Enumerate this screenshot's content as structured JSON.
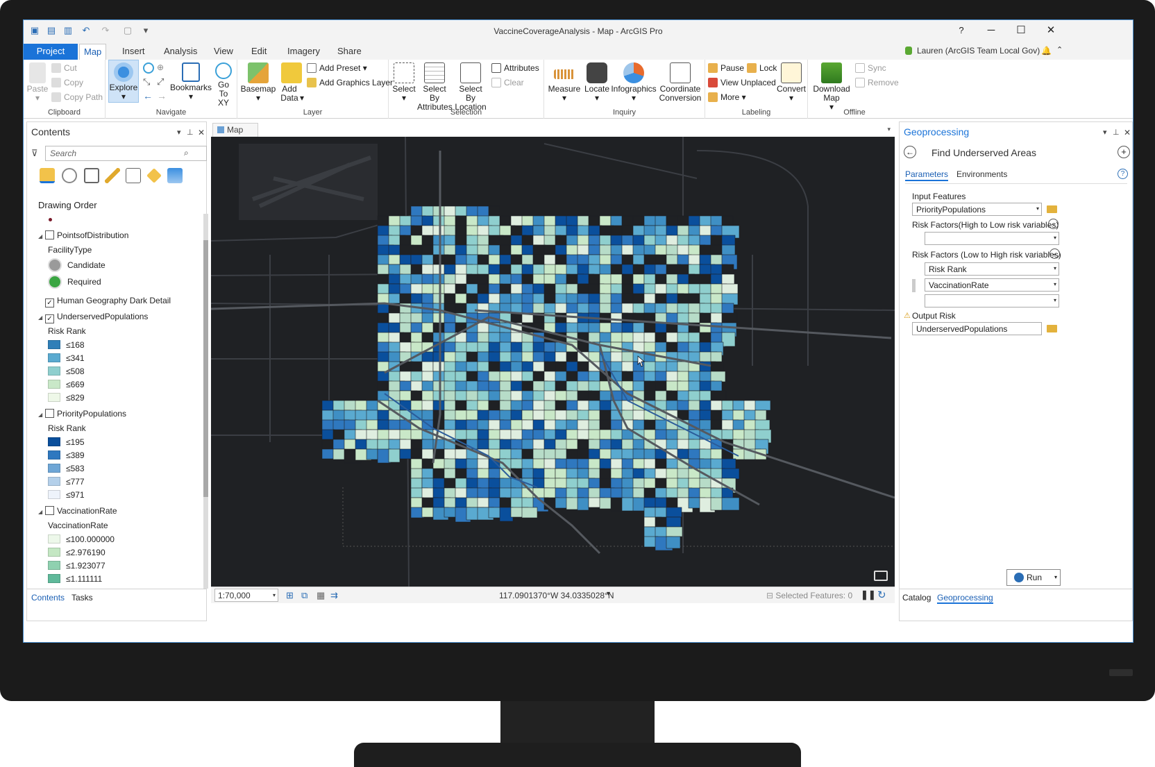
{
  "window": {
    "title": "VaccineCoverageAnalysis - Map - ArcGIS Pro",
    "help": "?"
  },
  "tabs": [
    "Project",
    "Map",
    "Insert",
    "Analysis",
    "View",
    "Edit",
    "Imagery",
    "Share"
  ],
  "active_tab": "Map",
  "user": "Lauren (ArcGIS Team Local Gov)",
  "ribbon": {
    "clipboard": {
      "label": "Clipboard",
      "paste": "Paste",
      "cut": "Cut",
      "copy": "Copy",
      "copy_path": "Copy Path"
    },
    "navigate": {
      "label": "Navigate",
      "explore": "Explore",
      "bookmarks": "Bookmarks",
      "go_to_xy": "Go To XY"
    },
    "layer": {
      "label": "Layer",
      "basemap": "Basemap",
      "add_data": "Add Data",
      "add_preset": "Add Preset",
      "add_graphics_layer": "Add Graphics Layer"
    },
    "selection": {
      "label": "Selection",
      "select": "Select",
      "select_by_attributes": "Select By Attributes",
      "select_by_location": "Select By Location",
      "attributes": "Attributes",
      "clear": "Clear"
    },
    "inquiry": {
      "label": "Inquiry",
      "measure": "Measure",
      "locate": "Locate",
      "infographics": "Infographics",
      "coordinate_conversion": "Coordinate Conversion"
    },
    "labeling": {
      "label": "Labeling",
      "pause": "Pause",
      "lock": "Lock",
      "view_unplaced": "View Unplaced",
      "more": "More",
      "convert": "Convert"
    },
    "offline": {
      "label": "Offline",
      "download_map": "Download Map",
      "sync": "Sync",
      "remove": "Remove"
    }
  },
  "contents": {
    "title": "Contents",
    "search_placeholder": "Search",
    "drawing_order": "Drawing Order",
    "layers": [
      {
        "name": "PointsofDistribution",
        "checked": false,
        "field": "FacilityType",
        "classes": [
          {
            "label": "Candidate"
          },
          {
            "label": "Required"
          }
        ]
      },
      {
        "name": "Human Geography Dark Detail",
        "checked": true
      },
      {
        "name": "UnderservedPopulations",
        "checked": true,
        "field": "Risk Rank",
        "classes": [
          {
            "label": "≤168",
            "color": "#2f7fb8"
          },
          {
            "label": "≤341",
            "color": "#5aaad0"
          },
          {
            "label": "≤508",
            "color": "#8fcfce"
          },
          {
            "label": "≤669",
            "color": "#c9e8c8"
          },
          {
            "label": "≤829",
            "color": "#eef8e8"
          }
        ]
      },
      {
        "name": "PriorityPopulations",
        "checked": false,
        "field": "Risk Rank",
        "classes": [
          {
            "label": "≤195",
            "color": "#0a4f9c"
          },
          {
            "label": "≤389",
            "color": "#2f78bf"
          },
          {
            "label": "≤583",
            "color": "#6ea6d6"
          },
          {
            "label": "≤777",
            "color": "#b4d0ea"
          },
          {
            "label": "≤971",
            "color": "#eef3fb"
          }
        ]
      },
      {
        "name": "VaccinationRate",
        "checked": false,
        "field": "VaccinationRate",
        "classes": [
          {
            "label": "≤100.000000",
            "color": "#edf8ea"
          },
          {
            "label": "≤2.976190",
            "color": "#c4e7c3"
          },
          {
            "label": "≤1.923077",
            "color": "#8fd1b0"
          },
          {
            "label": "≤1.111111",
            "color": "#5fb99a"
          }
        ]
      }
    ],
    "bottom_tabs": [
      "Contents",
      "Tasks"
    ]
  },
  "map": {
    "tab_label": "Map",
    "scale": "1:70,000",
    "coordinates": "117.0901370°W 34.0335028°N",
    "selected_features": "Selected Features: 0"
  },
  "geoprocessing": {
    "title": "Geoprocessing",
    "tool_title": "Find Underserved Areas",
    "tabs": [
      "Parameters",
      "Environments"
    ],
    "input_features_label": "Input Features",
    "input_features_value": "PriorityPopulations",
    "risk_high_low_label": "Risk Factors(High to Low risk variables)",
    "risk_low_high_label": "Risk Factors (Low to High risk variables)",
    "risk_low_high_values": [
      "Risk Rank",
      "VaccinationRate"
    ],
    "output_label": "Output Risk",
    "output_value": "UnderservedPopulations",
    "run": "Run",
    "bottom_tabs": [
      "Catalog",
      "Geoprocessing"
    ]
  },
  "colors": {
    "accent": "#1a73d8",
    "map_background": "#1f2124"
  }
}
